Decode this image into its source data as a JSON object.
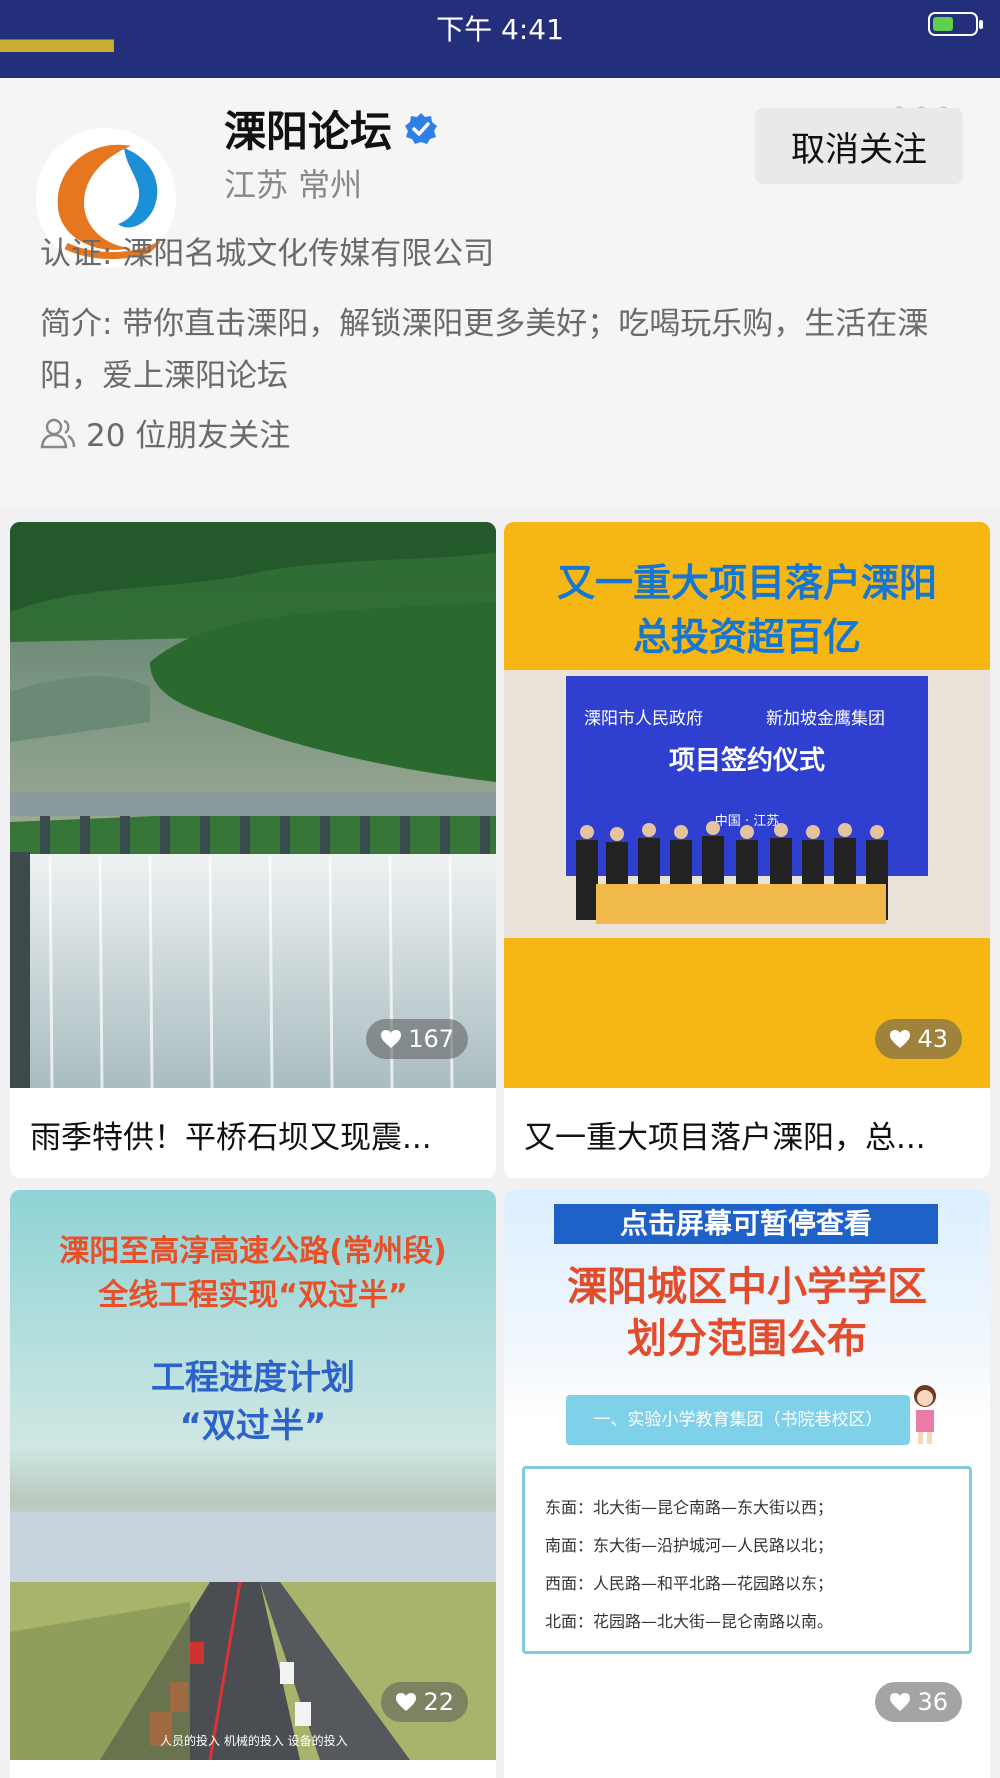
{
  "status_bar": {
    "time": "下午 4:41"
  },
  "profile": {
    "name": "溧阳论坛",
    "location": "江苏 常州",
    "follow_button": "取消关注",
    "certification": "认证: 溧阳名城文化传媒有限公司",
    "intro": "简介: 带你直击溧阳，解锁溧阳更多美好；吃喝玩乐购，生活在溧阳，爱上溧阳论坛",
    "friends_following": "20 位朋友关注"
  },
  "posts": [
    {
      "title": "雨季特供！平桥石坝又现震...",
      "likes": "167"
    },
    {
      "title": "又一重大项目落户溧阳，总...",
      "likes": "43",
      "overlay_line1": "又一重大项目落户溧阳",
      "overlay_line2": "总投资超百亿",
      "screen_left": "溧阳市人民政府",
      "screen_right": "新加坡金鹰集团",
      "screen_title": "项目签约仪式",
      "screen_sub": "中国 · 江苏"
    },
    {
      "title": "",
      "likes": "22",
      "overlay_line1": "溧阳至高淳高速公路(常州段)",
      "overlay_line2": "全线工程实现“双过半”",
      "overlay_line3": "工程进度计划",
      "overlay_line4": "“双过半”",
      "caption": "人员的投入 机械的投入 设备的投入"
    },
    {
      "title": "",
      "likes": "36",
      "banner": "点击屏幕可暂停查看",
      "overlay_line1": "溧阳城区中小学学区",
      "overlay_line2": "划分范围公布",
      "section": "一、实验小学教育集团（书院巷校区）",
      "lines": [
        "东面：北大街—昆仑南路—东大街以西；",
        "南面：东大街—沿护城河—人民路以北；",
        "西面：人民路—和平北路—花园路以东；",
        "北面：花园路—北大街—昆仑南路以南。"
      ]
    }
  ]
}
